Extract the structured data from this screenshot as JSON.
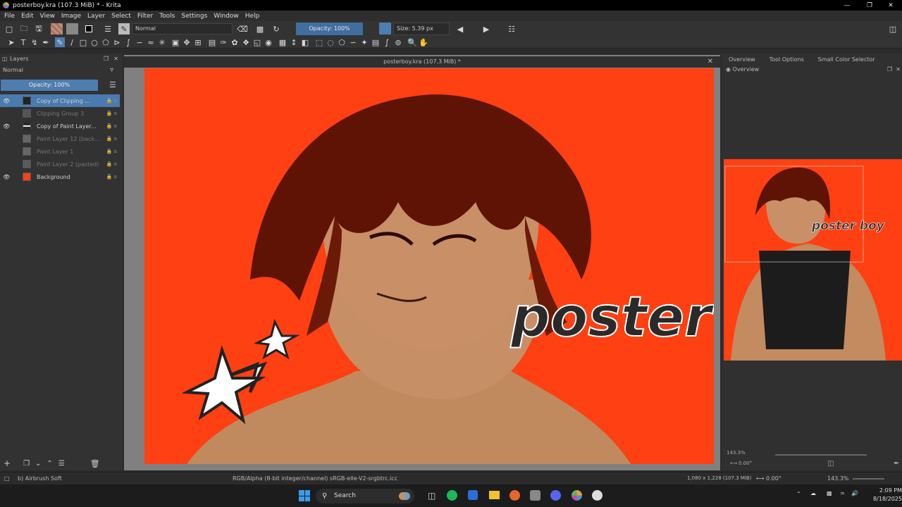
{
  "window": {
    "title": "posterboy.kra (107.3 MiB) * - Krita"
  },
  "menu": [
    "File",
    "Edit",
    "View",
    "Image",
    "Layer",
    "Select",
    "Filter",
    "Tools",
    "Settings",
    "Window",
    "Help"
  ],
  "toolbar": {
    "blend_mode": "Normal",
    "opacity": "Opacity: 100%",
    "size": "Size: 5.39 px"
  },
  "layers_panel": {
    "title": "Layers",
    "blend_mode": "Normal",
    "opacity": "Opacity: 100%",
    "layers": [
      {
        "name": "Copy of Clipping ...",
        "selected": true,
        "visible": true
      },
      {
        "name": "Clipping Group 3",
        "selected": false,
        "visible": false
      },
      {
        "name": "Copy of Paint Layer...",
        "selected": false,
        "visible": true
      },
      {
        "name": "Paint Layer 12 (back...",
        "selected": false,
        "visible": false
      },
      {
        "name": "Paint Layer 1",
        "selected": false,
        "visible": false
      },
      {
        "name": "Paint Layer 2 (pasted)",
        "selected": false,
        "visible": false
      },
      {
        "name": "Background",
        "selected": false,
        "visible": true
      }
    ]
  },
  "canvas": {
    "document_title": "posterboy.kra (107.3 MiB) *",
    "artwork_text": "poster",
    "bg_color": "#fe4012"
  },
  "right_panel": {
    "tabs": [
      "Overview",
      "Tool Options",
      "Small Color Selector"
    ],
    "overview_title": "Overview",
    "overview_text": "poster boy",
    "zoom": "143.3%",
    "rotation": "0.00°"
  },
  "statusbar": {
    "brush": "b) Airbrush Soft",
    "color_info": "RGB/Alpha (8-bit integer/channel)  sRGB-elle-V2-srgbtrc.icc",
    "dims": "1,080 x 1,228 (107.3 MiB)",
    "rotation": "0.00°",
    "zoom": "143.3%"
  },
  "taskbar": {
    "search": "Search",
    "time": "2:09 PM",
    "date": "8/18/2025"
  }
}
